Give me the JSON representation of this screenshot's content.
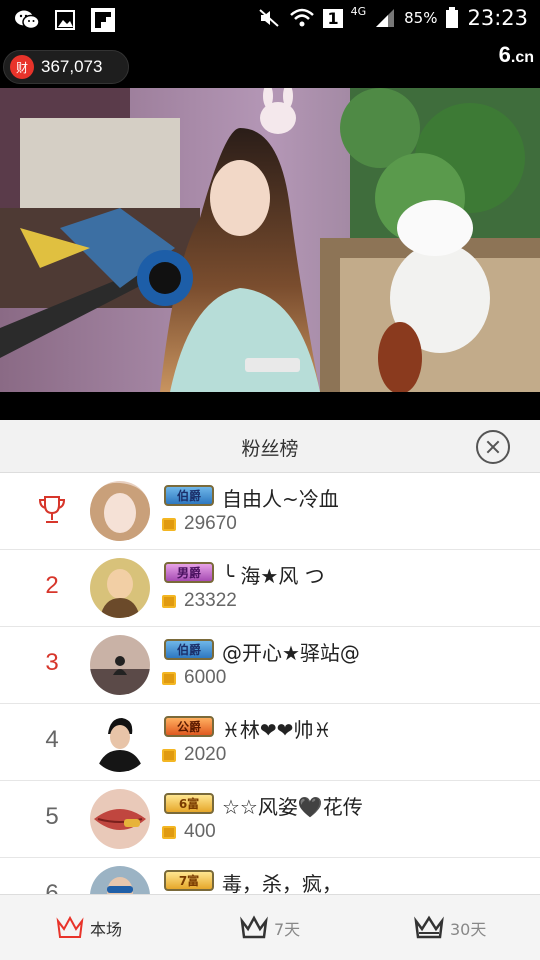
{
  "status_bar": {
    "network": "4G",
    "sim": "1",
    "battery": "85%",
    "time": "23:23"
  },
  "room": {
    "wealth_badge": "财",
    "wealth_value": "367,073",
    "logo": "6",
    "logo_suffix": ".cn"
  },
  "panel": {
    "title": "粉丝榜"
  },
  "fans": [
    {
      "rank": "",
      "badge": "伯爵",
      "badge_style": "blue",
      "name": "自由人~冷血",
      "coins": "29670"
    },
    {
      "rank": "2",
      "badge": "男爵",
      "badge_style": "pink",
      "name": "╰ 海★风 つ",
      "coins": "23322"
    },
    {
      "rank": "3",
      "badge": "伯爵",
      "badge_style": "blue",
      "name": "@开心★驿站@",
      "coins": "6000"
    },
    {
      "rank": "4",
      "badge": "公爵",
      "badge_style": "red",
      "name": "♓林❤❤帅♓",
      "coins": "2020"
    },
    {
      "rank": "5",
      "badge": "6富",
      "badge_style": "gold",
      "name": "☆☆风姿🖤花传",
      "coins": "400"
    },
    {
      "rank": "6",
      "badge": "7富",
      "badge_style": "gold",
      "name": "毒，杀，疯，",
      "coins": ""
    }
  ],
  "tabs": [
    {
      "label": "本场"
    },
    {
      "label": "7天"
    },
    {
      "label": "30天"
    }
  ],
  "colors": {
    "accent_red": "#d7362b",
    "tab_active": "#e8332a"
  }
}
